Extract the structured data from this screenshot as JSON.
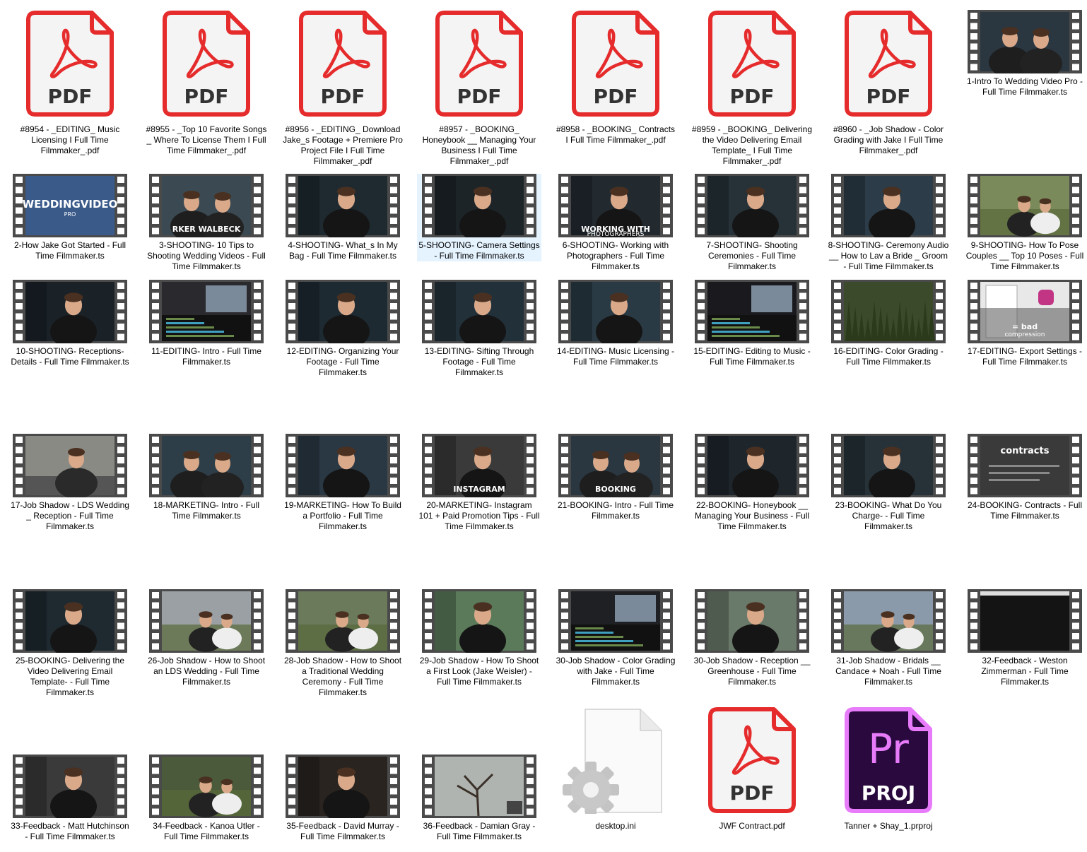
{
  "files": [
    {
      "type": "pdf",
      "label": "#8954 - _EDITING_ Music Licensing I Full Time Filmmaker_.pdf",
      "badge": "PDF"
    },
    {
      "type": "pdf",
      "label": "#8955 - _Top 10 Favorite Songs _ Where To License Them I Full Time Filmmaker_.pdf",
      "badge": "PDF"
    },
    {
      "type": "pdf",
      "label": "#8956 - _EDITING_ Download Jake_s Footage + Premiere Pro Project File I Full Time Filmmaker_.pdf",
      "badge": "PDF"
    },
    {
      "type": "pdf",
      "label": "#8957 - _BOOKING_ Honeybook __ Managing Your Business I Full Time Filmmaker_.pdf",
      "badge": "PDF"
    },
    {
      "type": "pdf",
      "label": "#8958 - _BOOKING_ Contracts I Full Time Filmmaker_.pdf",
      "badge": "PDF"
    },
    {
      "type": "pdf",
      "label": "#8959 - _BOOKING_ Delivering the Video Delivering Email Template_ I Full Time Filmmaker_.pdf",
      "badge": "PDF"
    },
    {
      "type": "pdf",
      "label": "#8960 - _Job Shadow - Color Grading with Jake I Full Time Filmmaker_.pdf",
      "badge": "PDF"
    },
    {
      "type": "video",
      "label": "1-Intro To Wedding Video Pro - Full Time Filmmaker.ts",
      "scene": "two",
      "bg": "#2a3640"
    },
    {
      "type": "video",
      "label": "2-How Jake Got Started - Full Time Filmmaker.ts",
      "scene": "title",
      "bg": "#3a5a8a",
      "overlay": "WEDDINGVIDEO",
      "overlay2": "PRO"
    },
    {
      "type": "video",
      "label": "3-SHOOTING- 10 Tips to Shooting Wedding Videos - Full Time Filmmaker.ts",
      "scene": "two",
      "bg": "#3b4a52",
      "overlay": "RKER WALBECK"
    },
    {
      "type": "video",
      "label": "4-SHOOTING- What_s In My Bag - Full Time Filmmaker.ts",
      "scene": "one",
      "bg": "#1e2a30"
    },
    {
      "type": "video",
      "label": "5-SHOOTING- Camera Settings - Full Time Filmmaker.ts",
      "scene": "one",
      "bg": "#1c2428",
      "selected": true
    },
    {
      "type": "video",
      "label": "6-SHOOTING- Working with Photographers - Full Time Filmmaker.ts",
      "scene": "one",
      "bg": "#222a30",
      "overlay": "WORKING WITH",
      "overlay2": "PHOTOGRAPHERS"
    },
    {
      "type": "video",
      "label": "7-SHOOTING- Shooting Ceremonies - Full Time Filmmaker.ts",
      "scene": "one",
      "bg": "#263238"
    },
    {
      "type": "video",
      "label": "8-SHOOTING- Ceremony Audio __ How to Lav a Bride _ Groom - Full Time Filmmaker.ts",
      "scene": "one",
      "bg": "#2c3c48"
    },
    {
      "type": "video",
      "label": "9-SHOOTING- How To Pose Couples __ Top 10 Poses - Full Time Filmmaker.ts",
      "scene": "outdoor",
      "bg": "#7a8a5a"
    },
    {
      "type": "video",
      "label": "10-SHOOTING- Receptions-Details - Full Time Filmmaker.ts",
      "scene": "one",
      "bg": "#1a2228"
    },
    {
      "type": "video",
      "label": "11-EDITING- Intro - Full Time Filmmaker.ts",
      "scene": "editor",
      "bg": "#2a2a2e"
    },
    {
      "type": "video",
      "label": "12-EDITING- Organizing Your Footage - Full Time Filmmaker.ts",
      "scene": "one",
      "bg": "#1e2a32"
    },
    {
      "type": "video",
      "label": "13-EDITING- Sifting Through Footage - Full Time Filmmaker.ts",
      "scene": "one",
      "bg": "#22303a"
    },
    {
      "type": "video",
      "label": "14-EDITING- Music Licensing - Full Time Filmmaker.ts",
      "scene": "one",
      "bg": "#2a3a44"
    },
    {
      "type": "video",
      "label": "15-EDITING- Editing to Music - Full Time Filmmaker.ts",
      "scene": "editor",
      "bg": "#1a1a1e"
    },
    {
      "type": "video",
      "label": "16-EDITING- Color Grading - Full Time Filmmaker.ts",
      "scene": "forest",
      "bg": "#3a4a2a"
    },
    {
      "type": "video",
      "label": "17-EDITING- Export Settings - Full Time Filmmaker.ts",
      "scene": "insta",
      "bg": "#e8e8e8",
      "overlay": "= bad",
      "overlay2": "compression"
    },
    {
      "type": "video",
      "label": "17-Job Shadow - LDS Wedding _ Reception - Full Time Filmmaker.ts",
      "scene": "gear",
      "bg": "#8a8a84"
    },
    {
      "type": "video",
      "label": "18-MARKETING- Intro - Full Time Filmmaker.ts",
      "scene": "two",
      "bg": "#2e3e48"
    },
    {
      "type": "video",
      "label": "19-MARKETING- How To Build a Portfolio - Full Time Filmmaker.ts",
      "scene": "one",
      "bg": "#2a3844"
    },
    {
      "type": "video",
      "label": "20-MARKETING- Instagram 101 + Paid Promotion Tips - Full Time Filmmaker.ts",
      "scene": "one",
      "bg": "#3a3a3a",
      "overlay": "INSTAGRAM"
    },
    {
      "type": "video",
      "label": "21-BOOKING- Intro - Full Time Filmmaker.ts",
      "scene": "two",
      "bg": "#2a3640",
      "overlay": "BOOKING"
    },
    {
      "type": "video",
      "label": "22-BOOKING- Honeybook __ Managing Your Business - Full Time Filmmaker.ts",
      "scene": "one",
      "bg": "#1e262c"
    },
    {
      "type": "video",
      "label": "23-BOOKING- What Do You Charge- - Full Time Filmmaker.ts",
      "scene": "one",
      "bg": "#263238"
    },
    {
      "type": "video",
      "label": "24-BOOKING- Contracts - Full Time Filmmaker.ts",
      "scene": "contract",
      "bg": "#3a3a3a",
      "overlay": "contracts"
    },
    {
      "type": "video",
      "label": "25-BOOKING- Delivering the Video Delivering Email Template- - Full Time Filmmaker.ts",
      "scene": "one",
      "bg": "#1e2a30"
    },
    {
      "type": "video",
      "label": "26-Job Shadow - How to Shoot an LDS Wedding - Full Time Filmmaker.ts",
      "scene": "outdoor",
      "bg": "#9aa0a4"
    },
    {
      "type": "video",
      "label": "28-Job Shadow - How to Shoot a Traditional Wedding Ceremony - Full Time Filmmaker.ts",
      "scene": "outdoor",
      "bg": "#6a7a5a"
    },
    {
      "type": "video",
      "label": "29-Job Shadow - How To Shoot a First Look (Jake Weisler) - Full Time Filmmaker.ts",
      "scene": "one",
      "bg": "#5a7a5a"
    },
    {
      "type": "video",
      "label": "30-Job Shadow - Color Grading with Jake - Full Time Filmmaker.ts",
      "scene": "editor",
      "bg": "#1e2024"
    },
    {
      "type": "video",
      "label": "30-Job Shadow - Reception __ Greenhouse - Full Time Filmmaker.ts",
      "scene": "one",
      "bg": "#6a7a6a"
    },
    {
      "type": "video",
      "label": "31-Job Shadow - Bridals __ Candace + Noah - Full Time Filmmaker.ts",
      "scene": "outdoor",
      "bg": "#8a9aaa"
    },
    {
      "type": "video",
      "label": "32-Feedback - Weston Zimmerman - Full Time Filmmaker.ts",
      "scene": "dark",
      "bg": "#141414"
    },
    {
      "type": "video",
      "label": "33-Feedback - Matt Hutchinson - Full Time Filmmaker.ts",
      "scene": "one",
      "bg": "#3a3a3a"
    },
    {
      "type": "video",
      "label": "34-Feedback - Kanoa Utler - Full Time Filmmaker.ts",
      "scene": "outdoor",
      "bg": "#4a5a3a"
    },
    {
      "type": "video",
      "label": "35-Feedback - David Murray - Full Time Filmmaker.ts",
      "scene": "one",
      "bg": "#2a2420"
    },
    {
      "type": "video",
      "label": "36-Feedback - Damian Gray - Full Time Filmmaker.ts",
      "scene": "tree",
      "bg": "#b0b4b0"
    },
    {
      "type": "ini",
      "label": "desktop.ini"
    },
    {
      "type": "pdf",
      "label": "JWF Contract.pdf",
      "badge": "PDF"
    },
    {
      "type": "prproj",
      "label": "Tanner + Shay_1.prproj",
      "badge": "PROJ",
      "logo": "Pr"
    }
  ],
  "colors": {
    "pdf_red": "#e52b2b",
    "pdf_fill": "#f4f4f4",
    "pr_purple": "#e77bfa",
    "pr_bg": "#2a0a3e",
    "selection": "#cce8ff"
  }
}
